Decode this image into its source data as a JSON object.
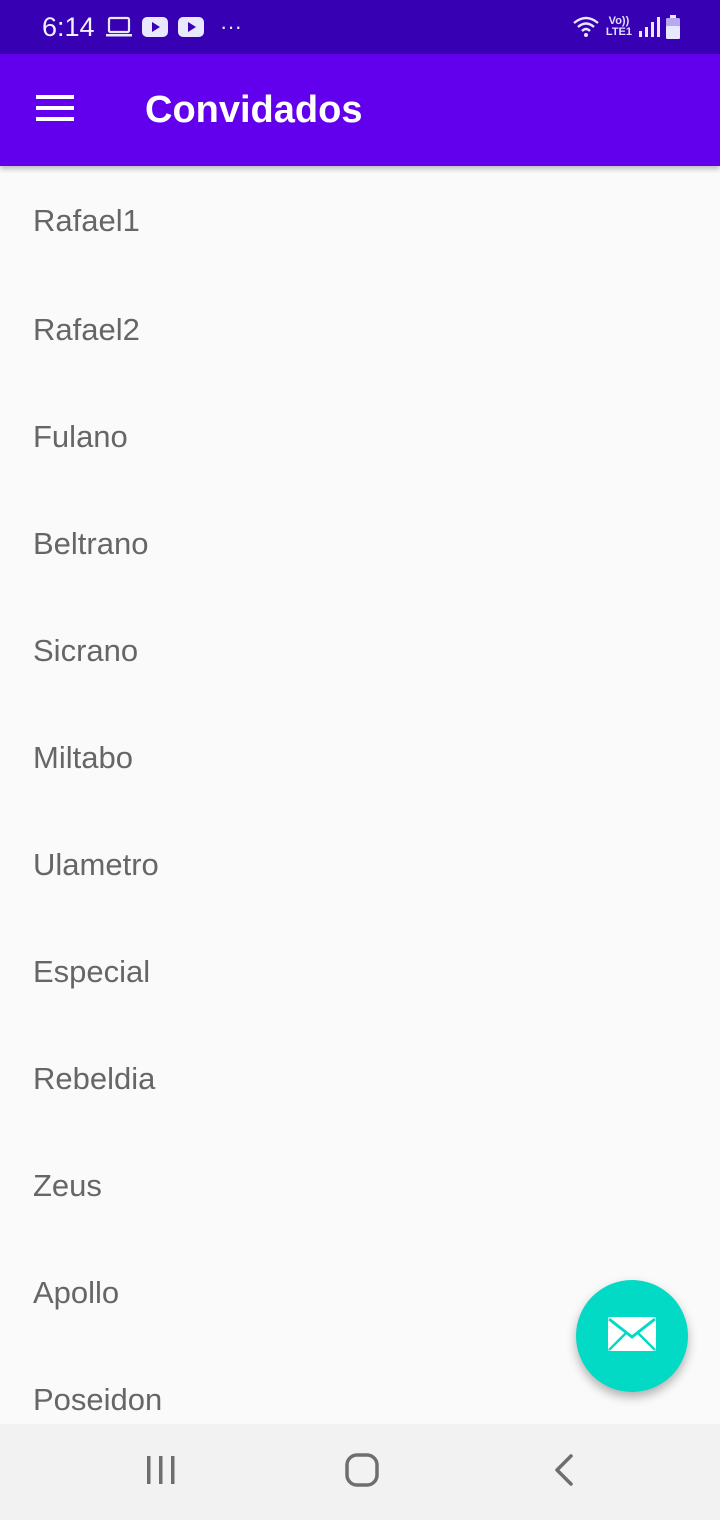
{
  "status_bar": {
    "time": "6:14",
    "more": "···",
    "volte_top": "Vo))",
    "volte_bottom": "LTE1",
    "icons_left": [
      "laptop-icon",
      "youtube-icon",
      "youtube-icon"
    ],
    "icons_right": [
      "wifi-icon",
      "volte-icon",
      "signal-icon",
      "battery-icon"
    ]
  },
  "app_bar": {
    "title": "Convidados",
    "menu_icon": "hamburger-menu-icon",
    "color": "#6200ee"
  },
  "guests": [
    "Rafael1",
    "Rafael2",
    "Fulano",
    "Beltrano",
    "Sicrano",
    "Miltabo",
    "Ulametro",
    "Especial",
    "Rebeldia",
    "Zeus",
    "Apollo",
    "Poseidon"
  ],
  "fab": {
    "icon": "mail-icon",
    "color": "#03dac5"
  },
  "nav_bar": {
    "icons": [
      "recent-apps-icon",
      "home-icon",
      "back-icon"
    ]
  }
}
